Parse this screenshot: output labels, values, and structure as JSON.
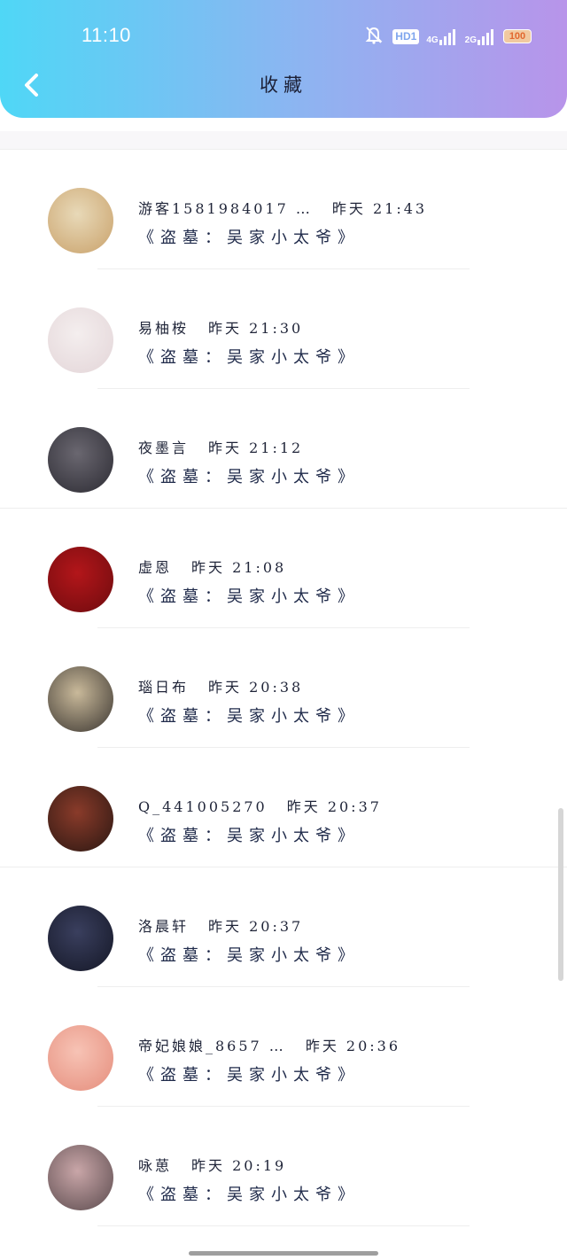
{
  "status_bar": {
    "time": "11:10",
    "hd_label": "HD1",
    "network_1": "4G",
    "network_2": "2G",
    "battery": "100"
  },
  "header": {
    "title": "收藏"
  },
  "items": [
    {
      "name": "游客1581984017 …",
      "time": "昨天 21:43",
      "work": "《盗墓：吴家小太爷》",
      "avatar_colors": [
        "#e8d9b8",
        "#c9a16a"
      ]
    },
    {
      "name": "易柚桉",
      "time": "昨天 21:30",
      "work": "《盗墓：吴家小太爷》",
      "avatar_colors": [
        "#f4eeee",
        "#e3d5d8"
      ]
    },
    {
      "name": "夜墨言",
      "time": "昨天 21:12",
      "work": "《盗墓：吴家小太爷》",
      "avatar_colors": [
        "#6a6770",
        "#2c2b33"
      ]
    },
    {
      "name": "虚恩",
      "time": "昨天 21:08",
      "work": "《盗墓：吴家小太爷》",
      "avatar_colors": [
        "#b3161a",
        "#6e0b0e"
      ]
    },
    {
      "name": "瑙日布",
      "time": "昨天 20:38",
      "work": "《盗墓：吴家小太爷》",
      "avatar_colors": [
        "#c9b99a",
        "#3a3530"
      ]
    },
    {
      "name": "Q_441005270",
      "time": "昨天 20:37",
      "work": "《盗墓：吴家小太爷》",
      "avatar_colors": [
        "#8a3b2a",
        "#2a1712"
      ]
    },
    {
      "name": "洛晨轩",
      "time": "昨天 20:37",
      "work": "《盗墓：吴家小太爷》",
      "avatar_colors": [
        "#3a3f5e",
        "#141726"
      ]
    },
    {
      "name": "帝妃娘娘_8657 …",
      "time": "昨天 20:36",
      "work": "《盗墓：吴家小太爷》",
      "avatar_colors": [
        "#f7c3b5",
        "#e58d7c"
      ]
    },
    {
      "name": "咏葸",
      "time": "昨天 20:19",
      "work": "《盗墓：吴家小太爷》",
      "avatar_colors": [
        "#c9a6a8",
        "#5a4a4d"
      ]
    }
  ],
  "colors": {
    "header_start": "#4fd7f6",
    "header_end": "#b894ea"
  }
}
